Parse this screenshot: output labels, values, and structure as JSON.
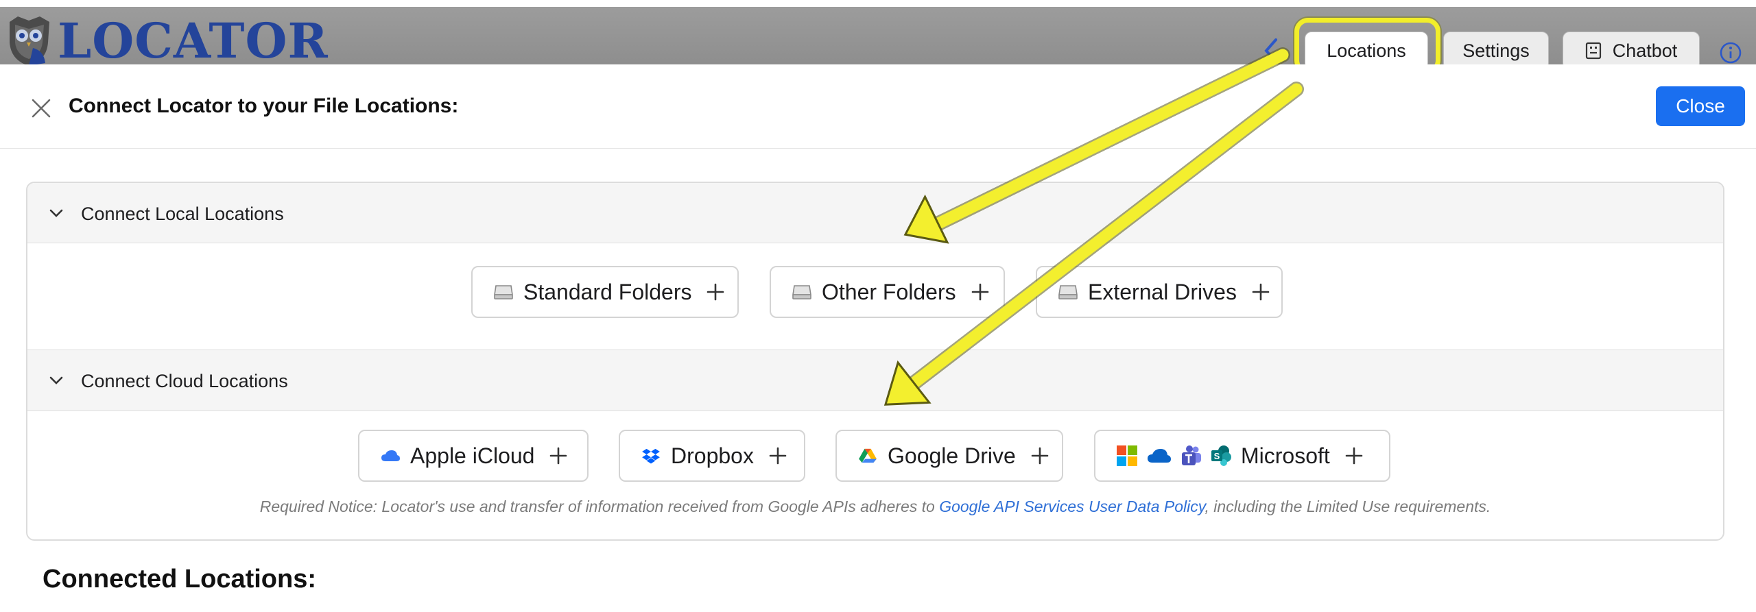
{
  "app": {
    "name": "LOCATOR"
  },
  "topbar": {
    "tabs": [
      {
        "label": "Locations"
      },
      {
        "label": "Settings"
      },
      {
        "label": "Chatbot"
      }
    ]
  },
  "modal": {
    "title": "Connect Locator to your File Locations:",
    "close_label": "Close"
  },
  "local": {
    "header": "Connect Local Locations",
    "buttons": [
      {
        "label": "Standard Folders",
        "icon": "drive-icon"
      },
      {
        "label": "Other Folders",
        "icon": "drive-icon"
      },
      {
        "label": "External Drives",
        "icon": "drive-icon"
      }
    ]
  },
  "cloud": {
    "header": "Connect Cloud Locations",
    "buttons": [
      {
        "label": "Apple iCloud",
        "icon": "icloud-icon"
      },
      {
        "label": "Dropbox",
        "icon": "dropbox-icon"
      },
      {
        "label": "Google Drive",
        "icon": "google-drive-icon"
      },
      {
        "label": "Microsoft",
        "icon": "microsoft-icons"
      }
    ]
  },
  "notice": {
    "prefix": "Required Notice: Locator's use and transfer of information received from Google APIs adheres to ",
    "link": "Google API Services User Data Policy",
    "suffix": ", including the Limited Use requirements."
  },
  "connected": {
    "title": "Connected Locations:"
  },
  "colors": {
    "accent": "#1a6ff0",
    "highlight": "#f2ee2a",
    "logo": "#24449a",
    "link": "#2f6fd6"
  }
}
